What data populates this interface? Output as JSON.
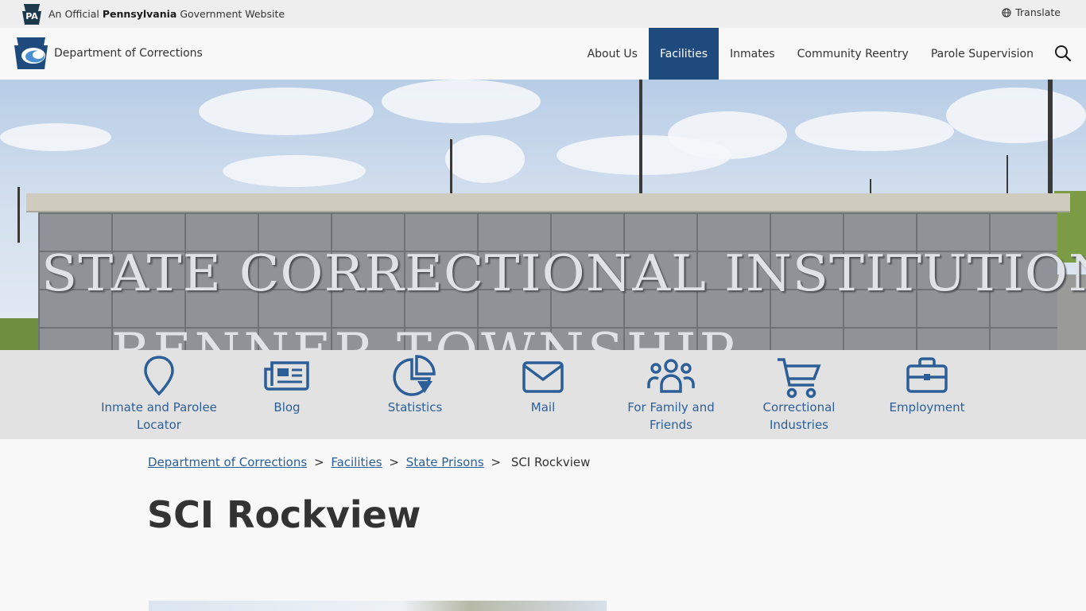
{
  "gov_bar": {
    "badge": "PA",
    "prefix": "An Official ",
    "state": "Pennsylvania",
    "suffix": " Government Website",
    "translate": "Translate"
  },
  "header": {
    "department": "Department of Corrections",
    "nav": [
      {
        "label": "About Us",
        "active": false
      },
      {
        "label": "Facilities",
        "active": true
      },
      {
        "label": "Inmates",
        "active": false
      },
      {
        "label": "Community Reentry",
        "active": false
      },
      {
        "label": "Parole Supervision",
        "active": false
      }
    ]
  },
  "hero": {
    "sign_line1": "STATE CORRECTIONAL INSTITUTION",
    "sign_line2": "BENNER TOWNSHIP"
  },
  "quick_links": [
    {
      "label": "Inmate and Parolee Locator",
      "icon": "map-pin-icon"
    },
    {
      "label": "Blog",
      "icon": "newspaper-icon"
    },
    {
      "label": "Statistics",
      "icon": "pie-chart-icon"
    },
    {
      "label": "Mail",
      "icon": "envelope-icon"
    },
    {
      "label": "For Family and Friends",
      "icon": "people-icon"
    },
    {
      "label": "Correctional Industries",
      "icon": "shopping-cart-icon"
    },
    {
      "label": "Employment",
      "icon": "briefcase-icon"
    }
  ],
  "breadcrumb": {
    "items": [
      "Department of Corrections",
      "Facilities",
      "State Prisons"
    ],
    "current": "SCI Rockview"
  },
  "page_title": "SCI Rockview",
  "colors": {
    "primary": "#1e4a7e",
    "link": "#2c5f98",
    "icon": "#2c5f98"
  }
}
